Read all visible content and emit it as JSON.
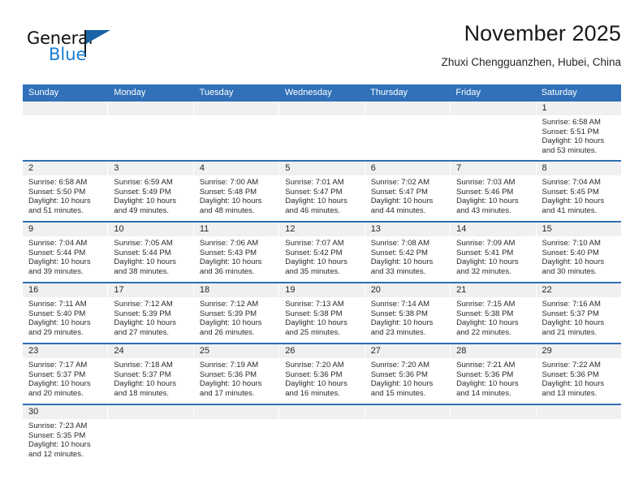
{
  "brand": {
    "word_one": "General",
    "word_two": "Blue",
    "flag_icon": "blue-flag-triangle",
    "accent_color": "#1763a6",
    "blue_text_color": "#1a7fd4"
  },
  "header": {
    "title": "November 2025",
    "subtitle": "Zhuxi Chengguanzhen, Hubei, China"
  },
  "theme": {
    "header_row_bg": "#3071b9",
    "week_separator": "#2f6fb4",
    "day_band_bg": "#f0f0f0",
    "text_color": "#2a2a2a"
  },
  "weekdays": [
    "Sunday",
    "Monday",
    "Tuesday",
    "Wednesday",
    "Thursday",
    "Friday",
    "Saturday"
  ],
  "weeks": [
    [
      {
        "empty": true
      },
      {
        "empty": true
      },
      {
        "empty": true
      },
      {
        "empty": true
      },
      {
        "empty": true
      },
      {
        "empty": true
      },
      {
        "day": "1",
        "sunrise": "Sunrise: 6:58 AM",
        "sunset": "Sunset: 5:51 PM",
        "daylight_line1": "Daylight: 10 hours",
        "daylight_line2": "and 53 minutes."
      }
    ],
    [
      {
        "day": "2",
        "sunrise": "Sunrise: 6:58 AM",
        "sunset": "Sunset: 5:50 PM",
        "daylight_line1": "Daylight: 10 hours",
        "daylight_line2": "and 51 minutes."
      },
      {
        "day": "3",
        "sunrise": "Sunrise: 6:59 AM",
        "sunset": "Sunset: 5:49 PM",
        "daylight_line1": "Daylight: 10 hours",
        "daylight_line2": "and 49 minutes."
      },
      {
        "day": "4",
        "sunrise": "Sunrise: 7:00 AM",
        "sunset": "Sunset: 5:48 PM",
        "daylight_line1": "Daylight: 10 hours",
        "daylight_line2": "and 48 minutes."
      },
      {
        "day": "5",
        "sunrise": "Sunrise: 7:01 AM",
        "sunset": "Sunset: 5:47 PM",
        "daylight_line1": "Daylight: 10 hours",
        "daylight_line2": "and 46 minutes."
      },
      {
        "day": "6",
        "sunrise": "Sunrise: 7:02 AM",
        "sunset": "Sunset: 5:47 PM",
        "daylight_line1": "Daylight: 10 hours",
        "daylight_line2": "and 44 minutes."
      },
      {
        "day": "7",
        "sunrise": "Sunrise: 7:03 AM",
        "sunset": "Sunset: 5:46 PM",
        "daylight_line1": "Daylight: 10 hours",
        "daylight_line2": "and 43 minutes."
      },
      {
        "day": "8",
        "sunrise": "Sunrise: 7:04 AM",
        "sunset": "Sunset: 5:45 PM",
        "daylight_line1": "Daylight: 10 hours",
        "daylight_line2": "and 41 minutes."
      }
    ],
    [
      {
        "day": "9",
        "sunrise": "Sunrise: 7:04 AM",
        "sunset": "Sunset: 5:44 PM",
        "daylight_line1": "Daylight: 10 hours",
        "daylight_line2": "and 39 minutes."
      },
      {
        "day": "10",
        "sunrise": "Sunrise: 7:05 AM",
        "sunset": "Sunset: 5:44 PM",
        "daylight_line1": "Daylight: 10 hours",
        "daylight_line2": "and 38 minutes."
      },
      {
        "day": "11",
        "sunrise": "Sunrise: 7:06 AM",
        "sunset": "Sunset: 5:43 PM",
        "daylight_line1": "Daylight: 10 hours",
        "daylight_line2": "and 36 minutes."
      },
      {
        "day": "12",
        "sunrise": "Sunrise: 7:07 AM",
        "sunset": "Sunset: 5:42 PM",
        "daylight_line1": "Daylight: 10 hours",
        "daylight_line2": "and 35 minutes."
      },
      {
        "day": "13",
        "sunrise": "Sunrise: 7:08 AM",
        "sunset": "Sunset: 5:42 PM",
        "daylight_line1": "Daylight: 10 hours",
        "daylight_line2": "and 33 minutes."
      },
      {
        "day": "14",
        "sunrise": "Sunrise: 7:09 AM",
        "sunset": "Sunset: 5:41 PM",
        "daylight_line1": "Daylight: 10 hours",
        "daylight_line2": "and 32 minutes."
      },
      {
        "day": "15",
        "sunrise": "Sunrise: 7:10 AM",
        "sunset": "Sunset: 5:40 PM",
        "daylight_line1": "Daylight: 10 hours",
        "daylight_line2": "and 30 minutes."
      }
    ],
    [
      {
        "day": "16",
        "sunrise": "Sunrise: 7:11 AM",
        "sunset": "Sunset: 5:40 PM",
        "daylight_line1": "Daylight: 10 hours",
        "daylight_line2": "and 29 minutes."
      },
      {
        "day": "17",
        "sunrise": "Sunrise: 7:12 AM",
        "sunset": "Sunset: 5:39 PM",
        "daylight_line1": "Daylight: 10 hours",
        "daylight_line2": "and 27 minutes."
      },
      {
        "day": "18",
        "sunrise": "Sunrise: 7:12 AM",
        "sunset": "Sunset: 5:39 PM",
        "daylight_line1": "Daylight: 10 hours",
        "daylight_line2": "and 26 minutes."
      },
      {
        "day": "19",
        "sunrise": "Sunrise: 7:13 AM",
        "sunset": "Sunset: 5:38 PM",
        "daylight_line1": "Daylight: 10 hours",
        "daylight_line2": "and 25 minutes."
      },
      {
        "day": "20",
        "sunrise": "Sunrise: 7:14 AM",
        "sunset": "Sunset: 5:38 PM",
        "daylight_line1": "Daylight: 10 hours",
        "daylight_line2": "and 23 minutes."
      },
      {
        "day": "21",
        "sunrise": "Sunrise: 7:15 AM",
        "sunset": "Sunset: 5:38 PM",
        "daylight_line1": "Daylight: 10 hours",
        "daylight_line2": "and 22 minutes."
      },
      {
        "day": "22",
        "sunrise": "Sunrise: 7:16 AM",
        "sunset": "Sunset: 5:37 PM",
        "daylight_line1": "Daylight: 10 hours",
        "daylight_line2": "and 21 minutes."
      }
    ],
    [
      {
        "day": "23",
        "sunrise": "Sunrise: 7:17 AM",
        "sunset": "Sunset: 5:37 PM",
        "daylight_line1": "Daylight: 10 hours",
        "daylight_line2": "and 20 minutes."
      },
      {
        "day": "24",
        "sunrise": "Sunrise: 7:18 AM",
        "sunset": "Sunset: 5:37 PM",
        "daylight_line1": "Daylight: 10 hours",
        "daylight_line2": "and 18 minutes."
      },
      {
        "day": "25",
        "sunrise": "Sunrise: 7:19 AM",
        "sunset": "Sunset: 5:36 PM",
        "daylight_line1": "Daylight: 10 hours",
        "daylight_line2": "and 17 minutes."
      },
      {
        "day": "26",
        "sunrise": "Sunrise: 7:20 AM",
        "sunset": "Sunset: 5:36 PM",
        "daylight_line1": "Daylight: 10 hours",
        "daylight_line2": "and 16 minutes."
      },
      {
        "day": "27",
        "sunrise": "Sunrise: 7:20 AM",
        "sunset": "Sunset: 5:36 PM",
        "daylight_line1": "Daylight: 10 hours",
        "daylight_line2": "and 15 minutes."
      },
      {
        "day": "28",
        "sunrise": "Sunrise: 7:21 AM",
        "sunset": "Sunset: 5:36 PM",
        "daylight_line1": "Daylight: 10 hours",
        "daylight_line2": "and 14 minutes."
      },
      {
        "day": "29",
        "sunrise": "Sunrise: 7:22 AM",
        "sunset": "Sunset: 5:36 PM",
        "daylight_line1": "Daylight: 10 hours",
        "daylight_line2": "and 13 minutes."
      }
    ],
    [
      {
        "day": "30",
        "sunrise": "Sunrise: 7:23 AM",
        "sunset": "Sunset: 5:35 PM",
        "daylight_line1": "Daylight: 10 hours",
        "daylight_line2": "and 12 minutes."
      },
      {
        "empty": true
      },
      {
        "empty": true
      },
      {
        "empty": true
      },
      {
        "empty": true
      },
      {
        "empty": true
      },
      {
        "empty": true
      }
    ]
  ]
}
